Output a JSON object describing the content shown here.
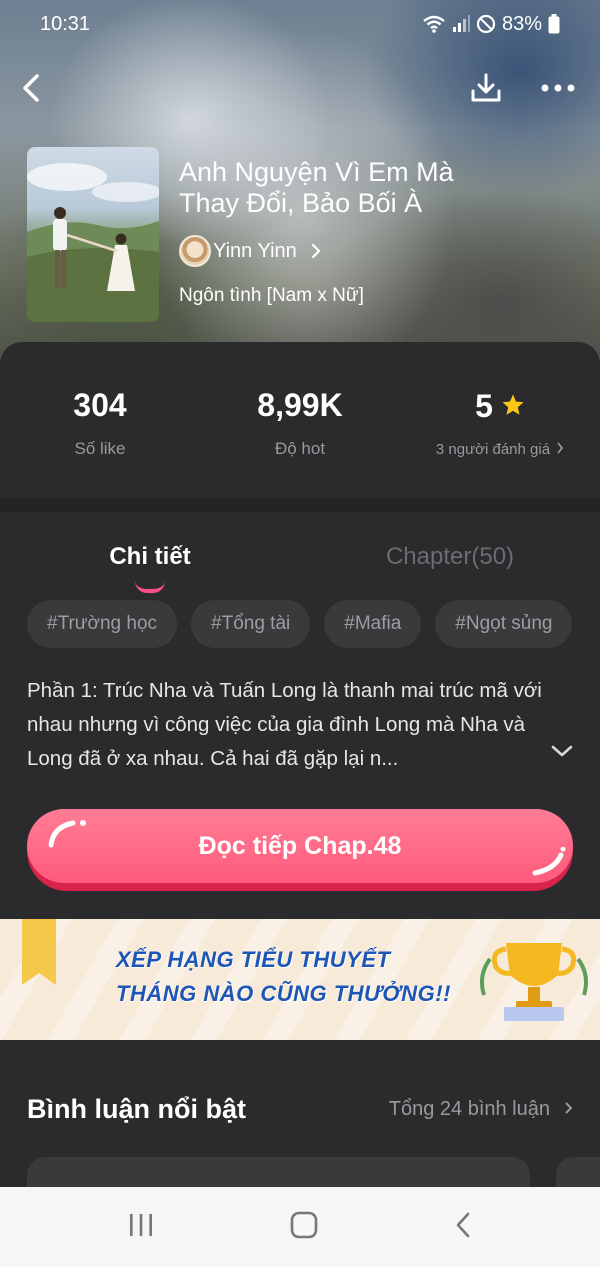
{
  "status_bar": {
    "time": "10:31",
    "battery": "83%"
  },
  "book": {
    "title": "Anh Nguyện Vì Em Mà Thay Đổi, Bảo Bối À",
    "author": "Yinn Yinn",
    "genre": "Ngôn tình [Nam x Nữ]"
  },
  "stats": [
    {
      "value": "304",
      "label": "Số like"
    },
    {
      "value": "8,99K",
      "label": "Độ hot"
    },
    {
      "value": "5",
      "label": "3 người đánh giá"
    }
  ],
  "tabs": {
    "details": "Chi tiết",
    "chapters": "Chapter(50)"
  },
  "tags": [
    "#Trường học",
    "#Tổng tài",
    "#Mafia",
    "#Ngọt sủng"
  ],
  "description": "Phần 1: Trúc Nha và Tuấn Long là thanh mai trúc mã với nhau nhưng vì công việc của gia đình Long mà Nha và Long đã ở xa nhau. Cả hai đã gặp lại n...",
  "read_button": "Đọc tiếp Chap.48",
  "banner": {
    "line1": "XẾP HẠNG TIỂU THUYẾT",
    "line2": "THÁNG NÀO CŨNG THƯỞNG!!"
  },
  "comments": {
    "title": "Bình luận nổi bật",
    "total": "Tổng 24 bình luận"
  },
  "colors": {
    "accent": "#ff5b7c",
    "star": "#ffc61a",
    "background": "#2b2b2d"
  },
  "icons": {
    "back": "back-arrow-icon",
    "download": "download-icon",
    "more": "more-icon",
    "star": "star-icon",
    "expand": "chevron-down-icon"
  }
}
